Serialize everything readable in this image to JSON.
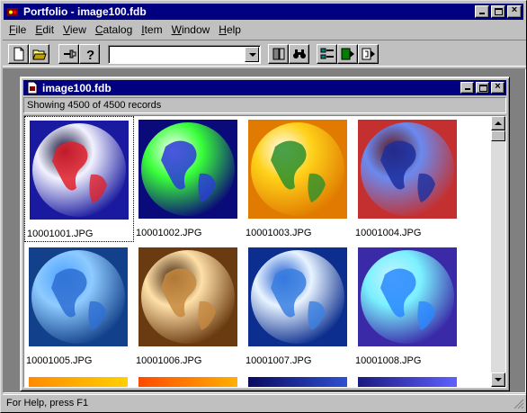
{
  "window": {
    "title": "Portfolio - image100.fdb"
  },
  "menu": [
    {
      "label": "File",
      "u": "F",
      "rest": "ile"
    },
    {
      "label": "Edit",
      "u": "E",
      "rest": "dit"
    },
    {
      "label": "View",
      "u": "V",
      "rest": "iew"
    },
    {
      "label": "Catalog",
      "u": "C",
      "rest": "atalog"
    },
    {
      "label": "Item",
      "u": "I",
      "rest": "tem"
    },
    {
      "label": "Window",
      "u": "W",
      "rest": "indow"
    },
    {
      "label": "Help",
      "u": "H",
      "rest": "elp"
    }
  ],
  "toolbar": {
    "combo_value": "",
    "buttons": [
      "new-icon",
      "open-folder-icon",
      "pin-icon",
      "help-question-icon",
      "find-icon",
      "binoculars-icon",
      "gallery-view-icon",
      "slideshow-icon",
      "export-icon"
    ]
  },
  "child": {
    "title": "image100.fdb",
    "records_status": "Showing 4500 of 4500 records"
  },
  "thumbnails": [
    {
      "name": "10001001.JPG",
      "colors": [
        "#f2f2ff",
        "#e0202a",
        "#1a1aa0",
        "#050530"
      ]
    },
    {
      "name": "10001002.JPG",
      "colors": [
        "#39ff39",
        "#2b3bd8",
        "#0a0a7a",
        "#ffffff"
      ]
    },
    {
      "name": "10001003.JPG",
      "colors": [
        "#ffd21a",
        "#2c8f2c",
        "#e07a00",
        "#ffffff"
      ]
    },
    {
      "name": "10001004.JPG",
      "colors": [
        "#6a8af0",
        "#1b2f9f",
        "#c43030",
        "#601010"
      ]
    },
    {
      "name": "10001005.JPG",
      "colors": [
        "#8ecbff",
        "#2e6fd4",
        "#12408a",
        "#4aa0ff"
      ]
    },
    {
      "name": "10001006.JPG",
      "colors": [
        "#ffe0a8",
        "#c58a40",
        "#6a3a10",
        "#3b1c05"
      ]
    },
    {
      "name": "10001007.JPG",
      "colors": [
        "#e8f4ff",
        "#3a7fe0",
        "#0c2f8f",
        "#1d5ad0"
      ]
    },
    {
      "name": "10001008.JPG",
      "colors": [
        "#7af0ff",
        "#2a88ff",
        "#3a2aa8",
        "#c8f4ff"
      ]
    }
  ],
  "statusbar": {
    "text": "For Help, press F1"
  },
  "colors": {
    "titlebar": "#000080",
    "face": "#c0c0c0",
    "workspace": "#808080"
  }
}
